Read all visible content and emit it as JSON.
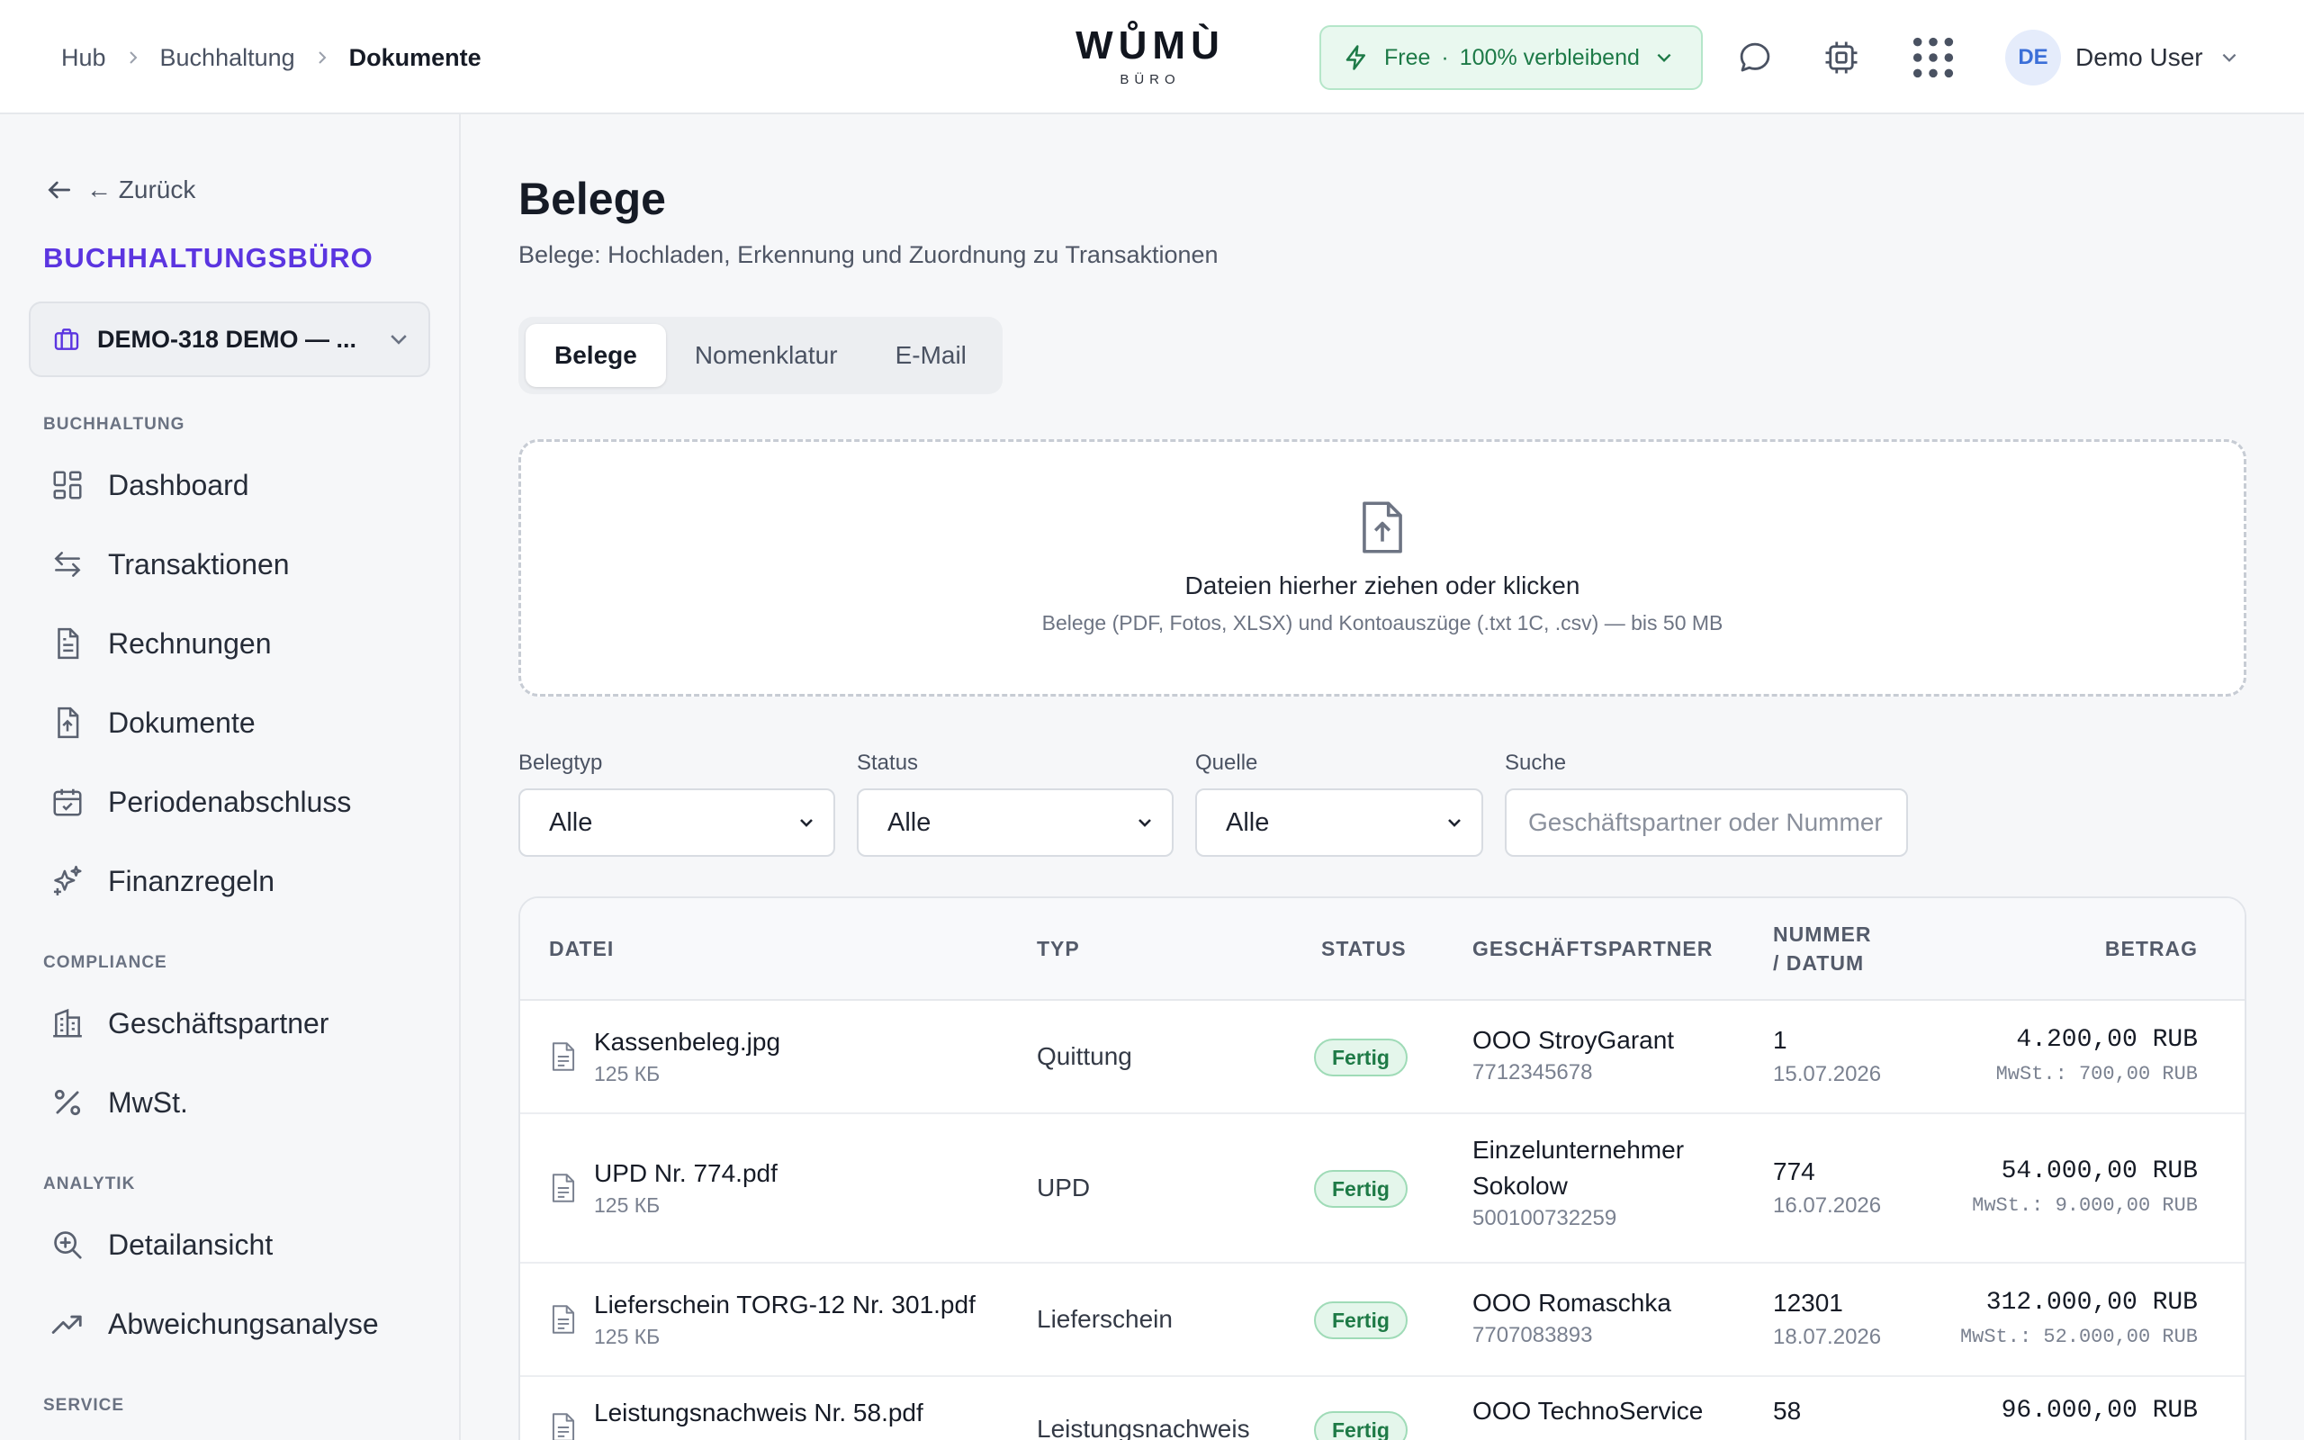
{
  "header": {
    "breadcrumb": [
      "Hub",
      "Buchhaltung",
      "Dokumente"
    ],
    "logo_main": "WŮMÙ",
    "logo_sub": "BÜRO",
    "plan": {
      "name": "Free",
      "separator": "·",
      "remaining": "100% verbleibend"
    },
    "icons": [
      "chat-icon",
      "cpu-icon",
      "apps-grid-icon"
    ],
    "user": {
      "initials": "DE",
      "name": "Demo User"
    }
  },
  "sidebar": {
    "back_label": "← Zurück",
    "org_title": "BUCHHALTUNGSBÜRO",
    "company": "DEMO-318 DEMO — ...",
    "sections": [
      {
        "label": "BUCHHALTUNG",
        "items": [
          {
            "label": "Dashboard",
            "icon": "dashboard-icon"
          },
          {
            "label": "Transaktionen",
            "icon": "transfer-arrows-icon"
          },
          {
            "label": "Rechnungen",
            "icon": "invoice-icon"
          },
          {
            "label": "Dokumente",
            "icon": "document-upload-icon"
          },
          {
            "label": "Periodenabschluss",
            "icon": "calendar-check-icon"
          },
          {
            "label": "Finanzregeln",
            "icon": "sparkles-icon"
          }
        ]
      },
      {
        "label": "COMPLIANCE",
        "items": [
          {
            "label": "Geschäftspartner",
            "icon": "building-icon"
          },
          {
            "label": "MwSt.",
            "icon": "percent-icon"
          }
        ]
      },
      {
        "label": "ANALYTIK",
        "items": [
          {
            "label": "Detailansicht",
            "icon": "zoom-icon"
          },
          {
            "label": "Abweichungsanalyse",
            "icon": "trend-up-icon"
          }
        ]
      },
      {
        "label": "SERVICE",
        "items": []
      }
    ]
  },
  "main": {
    "title": "Belege",
    "subtitle": "Belege: Hochladen, Erkennung und Zuordnung zu Transaktionen",
    "tabs": [
      "Belege",
      "Nomenklatur",
      "E-Mail"
    ],
    "dropzone": {
      "title": "Dateien hierher ziehen oder klicken",
      "hint": "Belege (PDF, Fotos, XLSX) und Kontoauszüge (.txt 1C, .csv) — bis 50 MB"
    },
    "filters": {
      "belegtyp": {
        "label": "Belegtyp",
        "value": "Alle"
      },
      "status": {
        "label": "Status",
        "value": "Alle"
      },
      "quelle": {
        "label": "Quelle",
        "value": "Alle"
      },
      "suche": {
        "label": "Suche",
        "placeholder": "Geschäftspartner oder Nummer"
      }
    },
    "table": {
      "columns": {
        "datei": "DATEI",
        "typ": "TYP",
        "status": "STATUS",
        "partner": "GESCHÄFTSPARTNER",
        "nummer_line1": "NUMMER",
        "nummer_line2": "/ DATUM",
        "betrag": "BETRAG"
      },
      "rows": [
        {
          "file": "Kassenbeleg.jpg",
          "size": "125 КБ",
          "type": "Quittung",
          "status": "Fertig",
          "partner": "OOO StroyGarant",
          "inn": "7712345678",
          "number": "1",
          "date": "15.07.2026",
          "amount": "4.200,00 RUB",
          "vat": "MwSt.: 700,00 RUB"
        },
        {
          "file": "UPD Nr. 774.pdf",
          "size": "125 КБ",
          "type": "UPD",
          "status": "Fertig",
          "partner": "Einzelunternehmer Sokolow",
          "inn": "500100732259",
          "number": "774",
          "date": "16.07.2026",
          "amount": "54.000,00 RUB",
          "vat": "MwSt.: 9.000,00 RUB"
        },
        {
          "file": "Lieferschein TORG-12 Nr. 301.pdf",
          "size": "125 КБ",
          "type": "Lieferschein",
          "status": "Fertig",
          "partner": "OOO Romaschka",
          "inn": "7707083893",
          "number": "12301",
          "date": "18.07.2026",
          "amount": "312.000,00 RUB",
          "vat": "MwSt.: 52.000,00 RUB"
        },
        {
          "file": "Leistungsnachweis Nr. 58.pdf",
          "size": "",
          "type": "Leistungsnachweis",
          "status": "Fertig",
          "partner": "OOO TechnoService",
          "inn": "",
          "number": "58",
          "date": "",
          "amount": "96.000,00 RUB",
          "vat": ""
        }
      ]
    }
  },
  "colors": {
    "accent": "#5b35e0",
    "status_green": "#1e7a46",
    "plan_bg": "#e9f8ef",
    "avatar_bg": "#e5ecfb"
  }
}
